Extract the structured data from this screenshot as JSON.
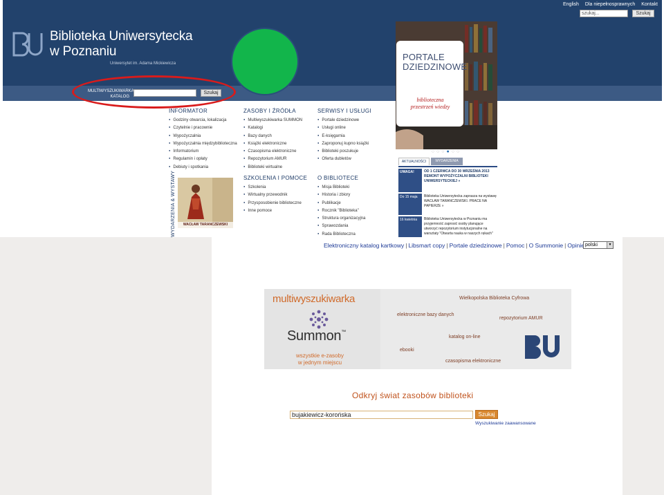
{
  "top_nav": {
    "links": [
      "English",
      "Dla niepełnosprawnych",
      "Kontakt"
    ],
    "search_placeholder": "szukaj...",
    "search_button": "Szukaj"
  },
  "header": {
    "title_line1": "Biblioteka Uniwersytecka",
    "title_line2": "w Poznaniu",
    "subtitle": "Uniwersytet im. Adama Mickiewicza",
    "logo_text": "BU"
  },
  "search_bar": {
    "label_line1": "MULTIWYSZUKIWARKA",
    "label_line2": "KATALOG",
    "button": "Szukaj"
  },
  "menu": {
    "informator": {
      "heading": "INFORMATOR",
      "items": [
        "Godziny otwarcia, lokalizacja",
        "Czytelnie i pracownie",
        "Wypożyczalnia",
        "Wypożyczalnia międzybiblioteczna",
        "Informatorium",
        "Regulamin i opłaty",
        "Debiuty i spotkania"
      ]
    },
    "zasoby": {
      "heading": "ZASOBY I ŹRÓDŁA",
      "items": [
        "Multiwyszukiwarka SUMMON",
        "Katalogi",
        "Bazy danych",
        "Książki elektroniczne",
        "Czasopisma elektroniczne",
        "Repozytorium AMUR",
        "Biblioteki wirtualne"
      ]
    },
    "serwisy": {
      "heading": "SERWISY I USŁUGI",
      "items": [
        "Portale dziedzinowe",
        "Usługi online",
        "E-księgarnia",
        "Zaproponuj kupno książki",
        "Biblioteki poszukuje",
        "Oferta dubletów"
      ]
    },
    "szkolenia": {
      "heading": "SZKOLENIA I POMOCE",
      "items": [
        "Szkolenia",
        "Wirtualny przewodnik",
        "Przysposobienie biblioteczne",
        "Inne pomoce"
      ]
    },
    "o_bibliotece": {
      "heading": "O BIBLIOTECE",
      "items": [
        "Misja Biblioteki",
        "Historia i zbiory",
        "Publikacje",
        "Rocznik \"Biblioteka\"",
        "Struktura organizacyjna",
        "Sprawozdania",
        "Rada Biblioteczna"
      ]
    }
  },
  "exhibitions": {
    "vertical_label": "WYDARZENIA & WYSTAWY",
    "caption": "WACŁAW TARANCZEWSKI"
  },
  "promo": {
    "title_line1": "PORTALE",
    "title_line2": "DZIEDZINOWE",
    "subtitle_line1": "biblioteczna",
    "subtitle_line2": "przestrzeń wiedzy"
  },
  "news": {
    "tab_active": "AKTUALNOŚCI",
    "tab_inactive": "WYDARZENIA",
    "rows": [
      {
        "date": "UWAGA!",
        "text": "OD 1 CZERWCA DO 30 WRZEŚNIA 2013 REMONT WYPOŻYCZALNI BIBLIOTEKI UNIWERSYTECKIEJ »"
      },
      {
        "date": "Do 15 maja",
        "text": "Biblioteka Uniwersytecka zaprasza na wystawę WACŁAW TARANCZEWSKI. PRACE NA PAPIERZE »"
      },
      {
        "date": "16 kwietnia",
        "text": "Biblioteka Uniwersytecka w Poznaniu ma przyjemność zaprosić osoby planujące utworzyć repozytorium instytucjonalne na warsztaty \"Otwarta nauka w naszych rękach\""
      }
    ]
  },
  "catalog_links": {
    "items": [
      "Elektroniczny katalog kartkowy",
      "Libsmart copy",
      "Portale dziedzinowe",
      "Pomoc",
      "O Summonie",
      "Opinie"
    ],
    "language": "polski"
  },
  "banner": {
    "multi": "multiwyszukiwarka",
    "summon": "Summon",
    "tm": "™",
    "tagline_line1": "wszystkie e-zasoby",
    "tagline_line2": "w jednym miejscu",
    "words": [
      "Wielkopolska Biblioteka Cyfrowa",
      "elektroniczne bazy danych",
      "repozytorium AMUR",
      "katalog on-line",
      "ebooki",
      "czasopisma elektroniczne"
    ]
  },
  "discover": {
    "heading": "Odkryj świat zasobów biblioteki",
    "query": "bujakiewicz-korońska",
    "button": "Szukaj",
    "advanced": "Wyszukiwanie zaawansowane"
  },
  "colors": {
    "header_blue": "#22426c",
    "highlight_red": "#d91b1b",
    "marker_green": "#12b54b",
    "summon_orange": "#d06a2a"
  }
}
